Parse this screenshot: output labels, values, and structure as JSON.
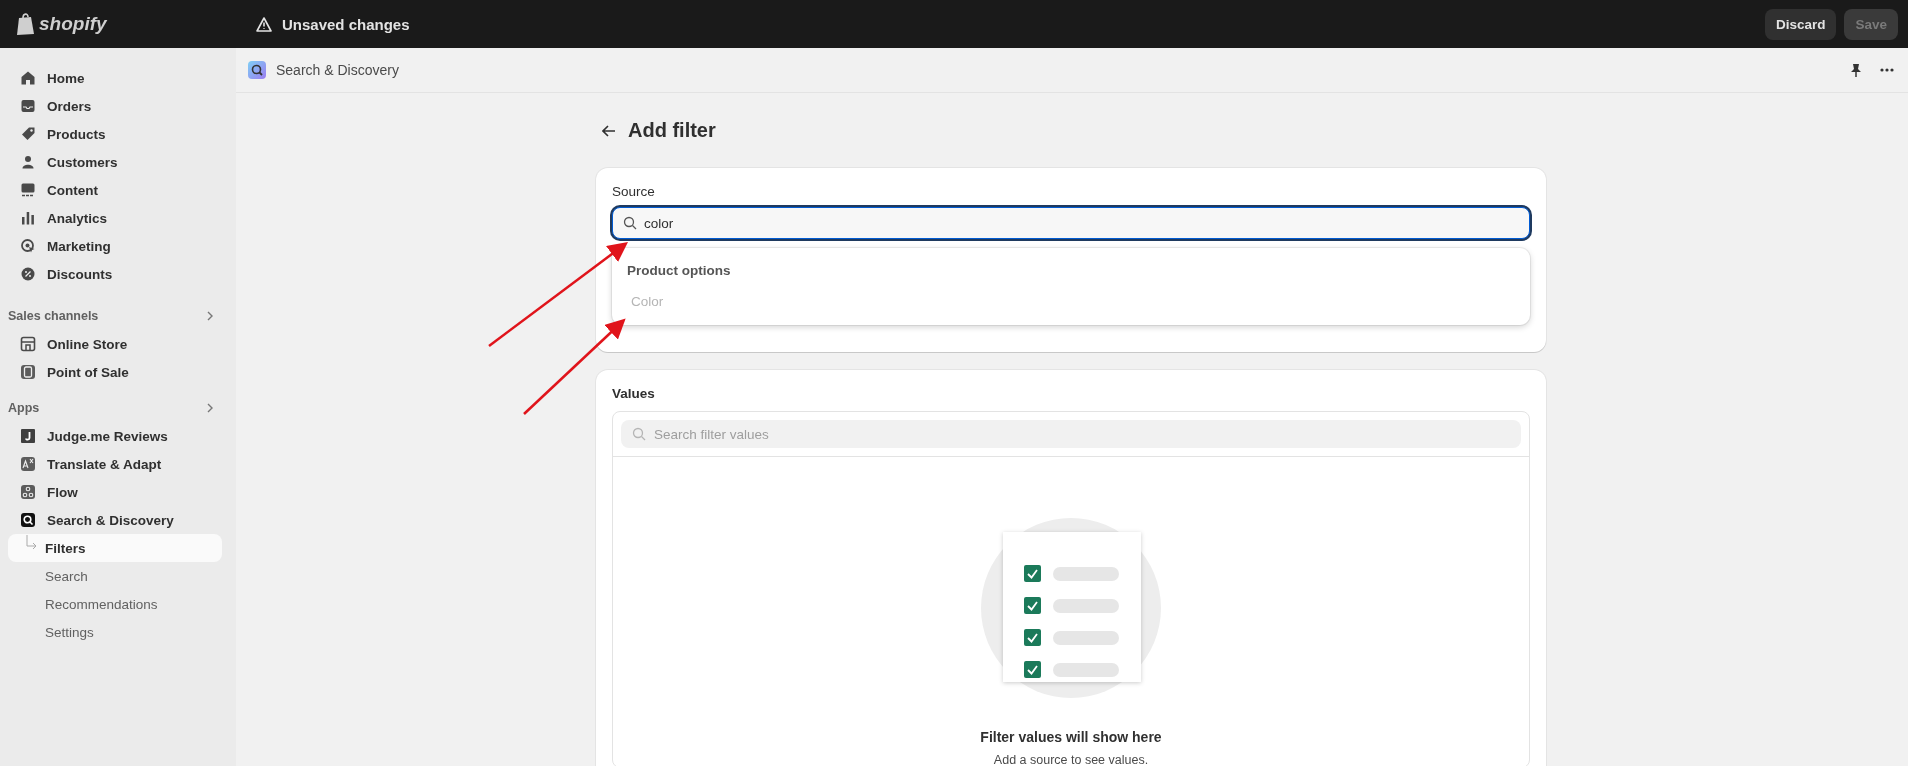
{
  "top_bar": {
    "logo": "shopify",
    "status": "Unsaved changes",
    "buttons": [
      {
        "label": "Discard",
        "disabled": false
      },
      {
        "label": "Save",
        "disabled": true
      }
    ]
  },
  "sidebar": {
    "main_items": [
      {
        "label": "Home"
      },
      {
        "label": "Orders"
      },
      {
        "label": "Products"
      },
      {
        "label": "Customers"
      },
      {
        "label": "Content"
      },
      {
        "label": "Analytics"
      },
      {
        "label": "Marketing"
      },
      {
        "label": "Discounts"
      }
    ],
    "sections": [
      {
        "title": "Sales channels",
        "items": [
          {
            "label": "Online Store"
          },
          {
            "label": "Point of Sale"
          }
        ]
      },
      {
        "title": "Apps",
        "items": [
          {
            "label": "Judge.me Reviews"
          },
          {
            "label": "Translate & Adapt"
          },
          {
            "label": "Flow"
          },
          {
            "label": "Search & Discovery",
            "children": [
              {
                "label": "Filters",
                "selected": true
              },
              {
                "label": "Search",
                "selected": false
              },
              {
                "label": "Recommendations",
                "selected": false
              },
              {
                "label": "Settings",
                "selected": false
              }
            ]
          }
        ]
      }
    ]
  },
  "app_bar": {
    "title": "Search & Discovery"
  },
  "page": {
    "title": "Add filter",
    "source": {
      "label": "Source",
      "value": "color",
      "dropdown": {
        "group": "Product options",
        "options": [
          {
            "label": "Color",
            "disabled": true
          }
        ]
      }
    },
    "values": {
      "title": "Values",
      "search_placeholder": "Search filter values",
      "empty_title": "Filter values will show here",
      "empty_text": "Add a source to see values."
    }
  }
}
